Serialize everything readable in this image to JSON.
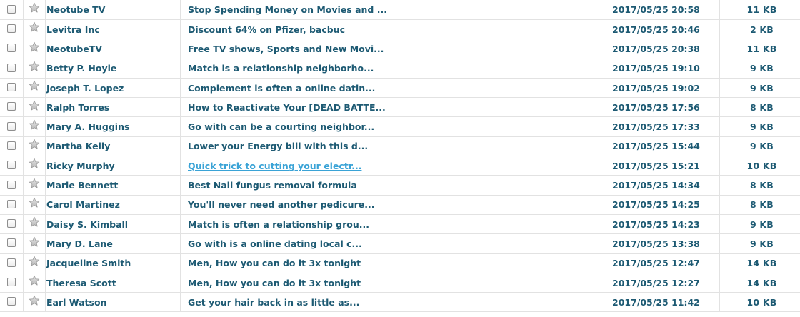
{
  "colors": {
    "text": "#1d5a73",
    "hover_link": "#3aa3d6",
    "grid": "#e2e2e2",
    "star": "#a9a9a9"
  },
  "messages": [
    {
      "sender": "Neotube TV",
      "subject": "Stop Spending Money on Movies and ...",
      "date": "2017/05/25 20:58",
      "size": "11 KB"
    },
    {
      "sender": "Levitra Inc",
      "subject": "Discount 64% on Pfizer, bacbuc",
      "date": "2017/05/25 20:46",
      "size": "2 KB"
    },
    {
      "sender": "NeotubeTV",
      "subject": "Free TV shows, Sports and New Movi...",
      "date": "2017/05/25 20:38",
      "size": "11 KB"
    },
    {
      "sender": "Betty P. Hoyle",
      "subject": "Match is a relationship neighborho...",
      "date": "2017/05/25 19:10",
      "size": "9 KB"
    },
    {
      "sender": "Joseph T. Lopez",
      "subject": "Complement is often a online datin...",
      "date": "2017/05/25 19:02",
      "size": "9 KB"
    },
    {
      "sender": "Ralph Torres",
      "subject": "How to Reactivate Your [DEAD BATTE...",
      "date": "2017/05/25 17:56",
      "size": "8 KB"
    },
    {
      "sender": "Mary A. Huggins",
      "subject": "Go with can be a courting neighbor...",
      "date": "2017/05/25 17:33",
      "size": "9 KB"
    },
    {
      "sender": "Martha Kelly",
      "subject": "Lower your Energy bill with this d...",
      "date": "2017/05/25 15:44",
      "size": "9 KB"
    },
    {
      "sender": "Ricky Murphy",
      "subject": "Quick trick to cutting your electr...",
      "date": "2017/05/25 15:21",
      "size": "10 KB",
      "hovered": true
    },
    {
      "sender": "Marie Bennett",
      "subject": "Best Nail fungus removal formula",
      "date": "2017/05/25 14:34",
      "size": "8 KB"
    },
    {
      "sender": "Carol Martinez",
      "subject": "You'll never need another pedicure...",
      "date": "2017/05/25 14:25",
      "size": "8 KB"
    },
    {
      "sender": "Daisy S. Kimball",
      "subject": "Match is often a relationship grou...",
      "date": "2017/05/25 14:23",
      "size": "9 KB"
    },
    {
      "sender": "Mary D. Lane",
      "subject": "Go with is a online dating local c...",
      "date": "2017/05/25 13:38",
      "size": "9 KB"
    },
    {
      "sender": "Jacqueline Smith",
      "subject": "Men, How you can do it 3x tonight",
      "date": "2017/05/25 12:47",
      "size": "14 KB"
    },
    {
      "sender": "Theresa Scott",
      "subject": "Men, How you can do it 3x tonight",
      "date": "2017/05/25 12:27",
      "size": "14 KB"
    },
    {
      "sender": "Earl Watson",
      "subject": "Get your hair back in as little as...",
      "date": "2017/05/25 11:42",
      "size": "10 KB"
    }
  ]
}
